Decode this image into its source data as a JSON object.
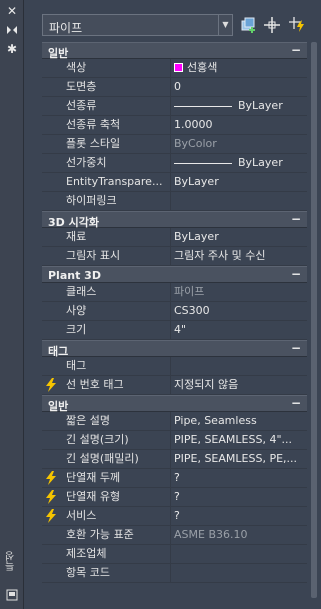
{
  "sidebar": {
    "close_icon": "close-icon",
    "arrows_icon": "collapse-arrows-icon",
    "settings_icon": "gear-icon",
    "vertical_label": "특성",
    "bottom_icon": "panel-icon"
  },
  "toolbar": {
    "selection_value": "파이프",
    "icons": [
      "add-to-selection-icon",
      "select-objects-icon",
      "quick-select-icon"
    ]
  },
  "sections": [
    {
      "title": "일반",
      "rows": [
        {
          "label": "색상",
          "value": "선홍색",
          "kind": "color",
          "color": "#ff00ff"
        },
        {
          "label": "도면층",
          "value": "0"
        },
        {
          "label": "선종류",
          "value": "ByLayer",
          "kind": "line"
        },
        {
          "label": "선종류 축척",
          "value": "1.0000"
        },
        {
          "label": "플롯 스타일",
          "value": "ByColor",
          "gray": true
        },
        {
          "label": "선가중치",
          "value": "ByLayer",
          "kind": "line"
        },
        {
          "label": "EntityTranspare...",
          "value": "ByLayer"
        },
        {
          "label": "하이퍼링크",
          "value": ""
        }
      ]
    },
    {
      "title": "3D 시각화",
      "rows": [
        {
          "label": "재료",
          "value": "ByLayer"
        },
        {
          "label": "그림자 표시",
          "value": "그림자 주사 및 수신"
        }
      ]
    },
    {
      "title": "Plant 3D",
      "rows": [
        {
          "label": "클래스",
          "value": "파이프",
          "gray": true
        },
        {
          "label": "사양",
          "value": "CS300"
        },
        {
          "label": "크기",
          "value": "4\""
        }
      ]
    },
    {
      "title": "태그",
      "rows": [
        {
          "label": "태그",
          "value": ""
        },
        {
          "label": "선 번호 태그",
          "value": "지정되지 않음",
          "bolt": true
        }
      ]
    },
    {
      "title": "일반",
      "rows": [
        {
          "label": "짧은 설명",
          "value": "Pipe, Seamless"
        },
        {
          "label": "긴 설명(크기)",
          "value": "PIPE, SEAMLESS, 4\"..."
        },
        {
          "label": "긴 설명(패밀리)",
          "value": "PIPE, SEAMLESS, PE,..."
        },
        {
          "label": "단열재 두께",
          "value": "?",
          "bolt": true
        },
        {
          "label": "단열재 유형",
          "value": "?",
          "bolt": true
        },
        {
          "label": "서비스",
          "value": "?",
          "bolt": true
        },
        {
          "label": "호환 가능 표준",
          "value": "ASME B36.10",
          "gray": true
        },
        {
          "label": "제조업체",
          "value": ""
        },
        {
          "label": "항목 코드",
          "value": ""
        }
      ]
    }
  ],
  "colors": {
    "accent_bolt": "#f5c400",
    "swatch": "#ff00ff"
  }
}
